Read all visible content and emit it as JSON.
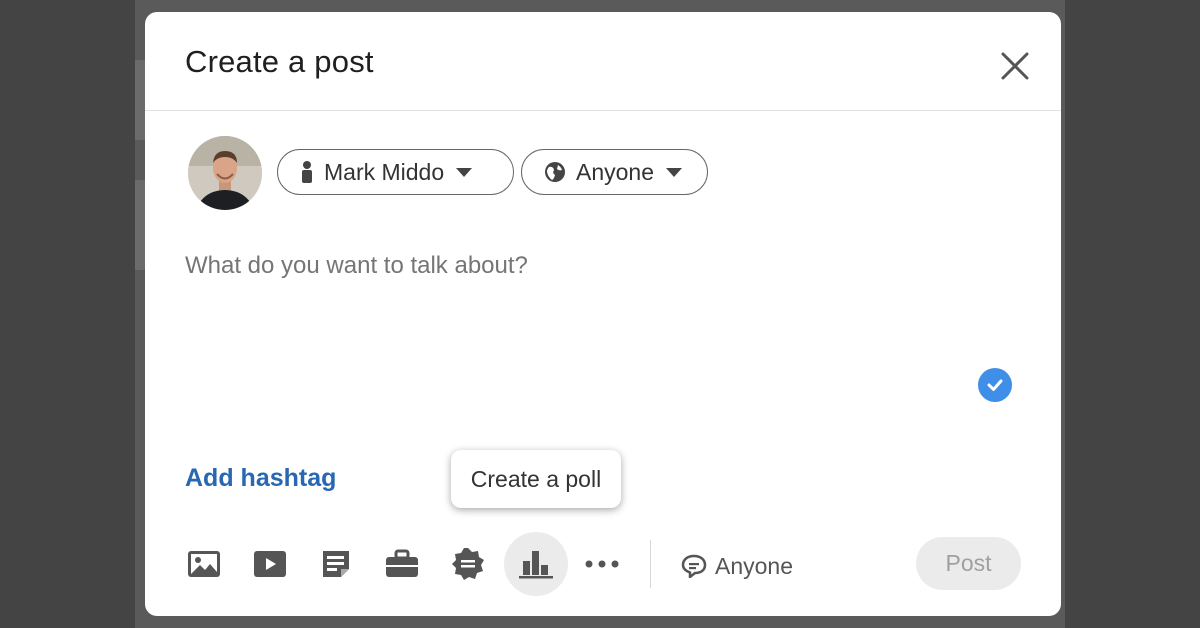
{
  "modal": {
    "title": "Create a post",
    "close_icon": "close-icon"
  },
  "author": {
    "avatar_icon": "profile-photo",
    "name": "Mark Middo",
    "person_icon": "person-icon"
  },
  "visibility": {
    "label": "Anyone",
    "icon": "globe-icon"
  },
  "editor": {
    "placeholder": "What do you want to talk about?"
  },
  "hashtag": {
    "label": "Add hashtag"
  },
  "tooltip": {
    "label": "Create a poll"
  },
  "toolbar": {
    "items": [
      {
        "name": "photo-icon"
      },
      {
        "name": "video-icon"
      },
      {
        "name": "document-icon"
      },
      {
        "name": "job-icon"
      },
      {
        "name": "celebrate-icon"
      },
      {
        "name": "poll-icon",
        "active": true
      },
      {
        "name": "more-icon"
      }
    ]
  },
  "comment_control": {
    "icon": "comment-icon",
    "label": "Anyone"
  },
  "post_button": {
    "label": "Post",
    "enabled": false
  },
  "colors": {
    "accent": "#2867b2",
    "check": "#3f8ee8",
    "overlay": "#444444"
  }
}
